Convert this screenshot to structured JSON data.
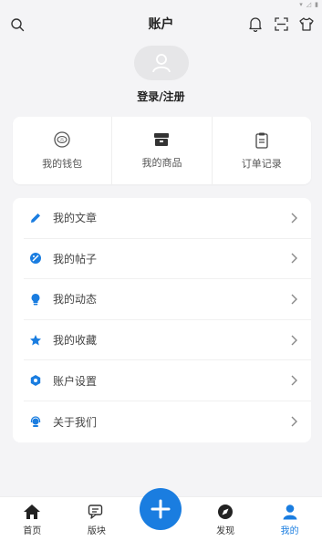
{
  "header": {
    "title": "账户"
  },
  "profile": {
    "login_text": "登录/注册"
  },
  "quick": [
    {
      "label": "我的钱包",
      "icon": "wallet-icon"
    },
    {
      "label": "我的商品",
      "icon": "shop-icon"
    },
    {
      "label": "订单记录",
      "icon": "clipboard-icon"
    }
  ],
  "menu": [
    {
      "label": "我的文章",
      "icon": "pencil-icon"
    },
    {
      "label": "我的帖子",
      "icon": "post-icon"
    },
    {
      "label": "我的动态",
      "icon": "bulb-icon"
    },
    {
      "label": "我的收藏",
      "icon": "star-icon"
    },
    {
      "label": "账户设置",
      "icon": "gear-icon"
    },
    {
      "label": "关于我们",
      "icon": "headset-icon"
    }
  ],
  "tabs": [
    {
      "label": "首页",
      "icon": "home-icon"
    },
    {
      "label": "版块",
      "icon": "chat-icon"
    },
    {
      "label": "",
      "icon": "plus-icon"
    },
    {
      "label": "发现",
      "icon": "compass-icon"
    },
    {
      "label": "我的",
      "icon": "user-icon"
    }
  ],
  "colors": {
    "accent": "#1a7de0",
    "background": "#f4f4f6"
  }
}
